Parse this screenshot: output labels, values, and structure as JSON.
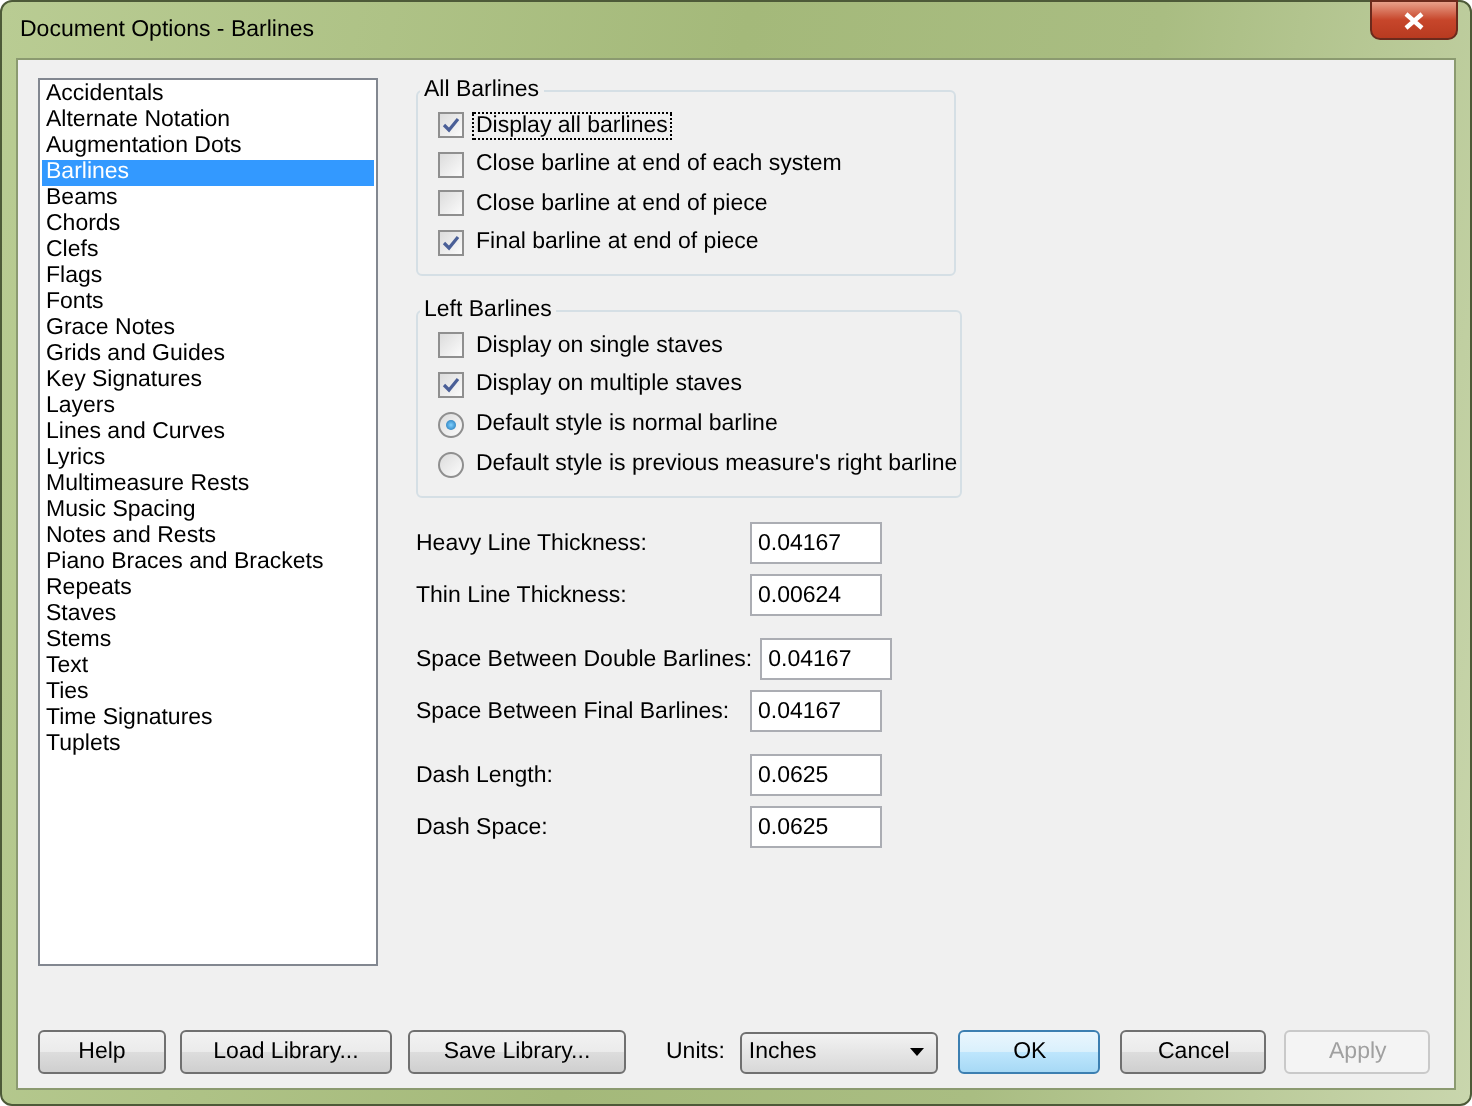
{
  "window": {
    "title": "Document Options - Barlines"
  },
  "categories": [
    {
      "label": "Accidentals",
      "selected": false
    },
    {
      "label": "Alternate Notation",
      "selected": false
    },
    {
      "label": "Augmentation Dots",
      "selected": false
    },
    {
      "label": "Barlines",
      "selected": true
    },
    {
      "label": "Beams",
      "selected": false
    },
    {
      "label": "Chords",
      "selected": false
    },
    {
      "label": "Clefs",
      "selected": false
    },
    {
      "label": "Flags",
      "selected": false
    },
    {
      "label": "Fonts",
      "selected": false
    },
    {
      "label": "Grace Notes",
      "selected": false
    },
    {
      "label": "Grids and Guides",
      "selected": false
    },
    {
      "label": "Key Signatures",
      "selected": false
    },
    {
      "label": "Layers",
      "selected": false
    },
    {
      "label": "Lines and Curves",
      "selected": false
    },
    {
      "label": "Lyrics",
      "selected": false
    },
    {
      "label": "Multimeasure Rests",
      "selected": false
    },
    {
      "label": "Music Spacing",
      "selected": false
    },
    {
      "label": "Notes and Rests",
      "selected": false
    },
    {
      "label": "Piano Braces and Brackets",
      "selected": false
    },
    {
      "label": "Repeats",
      "selected": false
    },
    {
      "label": "Staves",
      "selected": false
    },
    {
      "label": "Stems",
      "selected": false
    },
    {
      "label": "Text",
      "selected": false
    },
    {
      "label": "Ties",
      "selected": false
    },
    {
      "label": "Time Signatures",
      "selected": false
    },
    {
      "label": "Tuplets",
      "selected": false
    }
  ],
  "groups": [
    {
      "title": "All Barlines",
      "options": [
        {
          "kind": "checkbox",
          "label": "Display all barlines",
          "checked": true,
          "focused": true
        },
        {
          "kind": "checkbox",
          "label": "Close barline at end of each system",
          "checked": false,
          "focused": false
        },
        {
          "kind": "checkbox",
          "label": "Close barline at end of piece",
          "checked": false,
          "focused": false
        },
        {
          "kind": "checkbox",
          "label": "Final barline at end of piece",
          "checked": true,
          "focused": false
        }
      ]
    },
    {
      "title": "Left Barlines",
      "options": [
        {
          "kind": "checkbox",
          "label": "Display on single staves",
          "checked": false,
          "focused": false
        },
        {
          "kind": "checkbox",
          "label": "Display on multiple staves",
          "checked": true,
          "focused": false
        },
        {
          "kind": "radio",
          "label": "Default style is normal barline",
          "selected": true,
          "focused": false
        },
        {
          "kind": "radio",
          "label": "Default style is previous measure's right barline",
          "selected": false,
          "focused": false
        }
      ]
    }
  ],
  "field_groups": [
    [
      {
        "label": "Heavy Line Thickness:",
        "value": "0.04167"
      },
      {
        "label": "Thin Line Thickness:",
        "value": "0.00624"
      }
    ],
    [
      {
        "label": "Space Between Double Barlines:",
        "value": "0.04167"
      },
      {
        "label": "Space Between Final Barlines:",
        "value": "0.04167"
      }
    ],
    [
      {
        "label": "Dash Length:",
        "value": "0.0625"
      },
      {
        "label": "Dash Space:",
        "value": "0.0625"
      }
    ]
  ],
  "footer": {
    "left_buttons": [
      {
        "label": "Help"
      },
      {
        "label": "Load Library..."
      },
      {
        "label": "Save Library..."
      }
    ],
    "units_label": "Units:",
    "units_value": "Inches",
    "right_buttons": [
      {
        "label": "OK",
        "default": true,
        "disabled": false
      },
      {
        "label": "Cancel",
        "default": false,
        "disabled": false
      },
      {
        "label": "Apply",
        "default": false,
        "disabled": true
      }
    ]
  }
}
